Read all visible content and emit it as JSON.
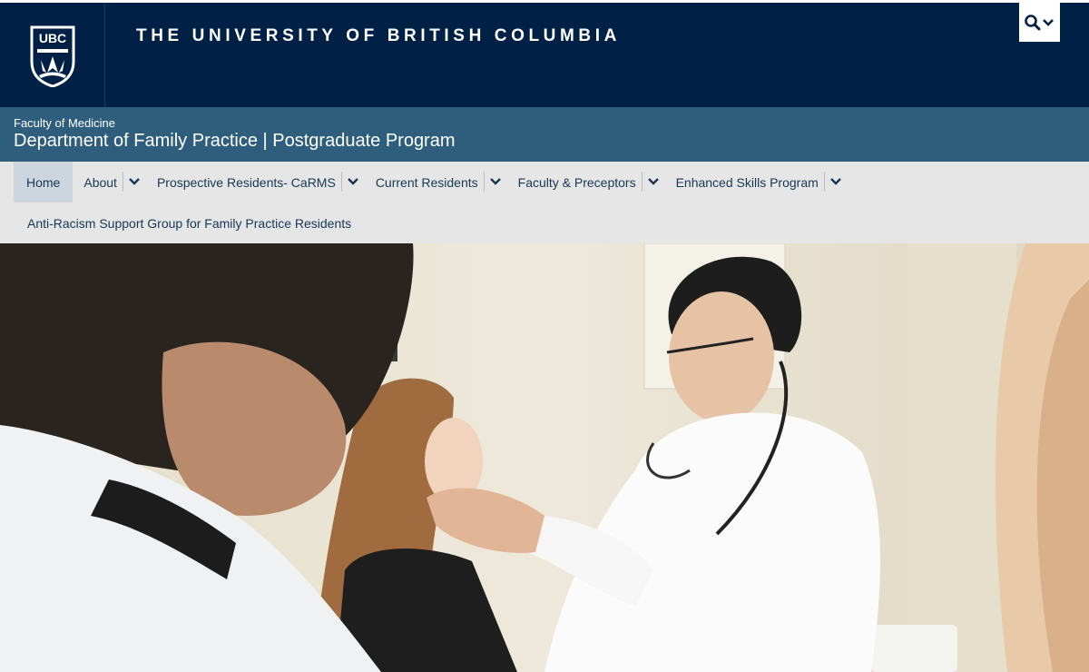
{
  "header": {
    "logo_text": "UBC",
    "wordmark": "THE UNIVERSITY OF BRITISH COLUMBIA",
    "search_icon": "search-icon",
    "search_caret_icon": "chevron-down-icon"
  },
  "unit": {
    "faculty": "Faculty of Medicine",
    "department": "Department of Family Practice | Postgraduate Program"
  },
  "nav": {
    "items": [
      {
        "label": "Home",
        "active": true,
        "has_dropdown": false
      },
      {
        "label": "About",
        "has_dropdown": true
      },
      {
        "label": "Prospective Residents- CaRMS",
        "has_dropdown": true
      },
      {
        "label": "Current Residents",
        "has_dropdown": true
      },
      {
        "label": "Faculty & Preceptors",
        "has_dropdown": true
      },
      {
        "label": "Enhanced Skills Program",
        "has_dropdown": true
      }
    ],
    "second_row": [
      {
        "label": "Anti-Racism Support Group for Family Practice Residents"
      }
    ]
  },
  "colors": {
    "ubc_navy": "#002145",
    "unit_bar": "#2f5d7c",
    "nav_bg": "#e6e6e6",
    "nav_active": "#cdd6df",
    "nav_text": "#173755"
  }
}
